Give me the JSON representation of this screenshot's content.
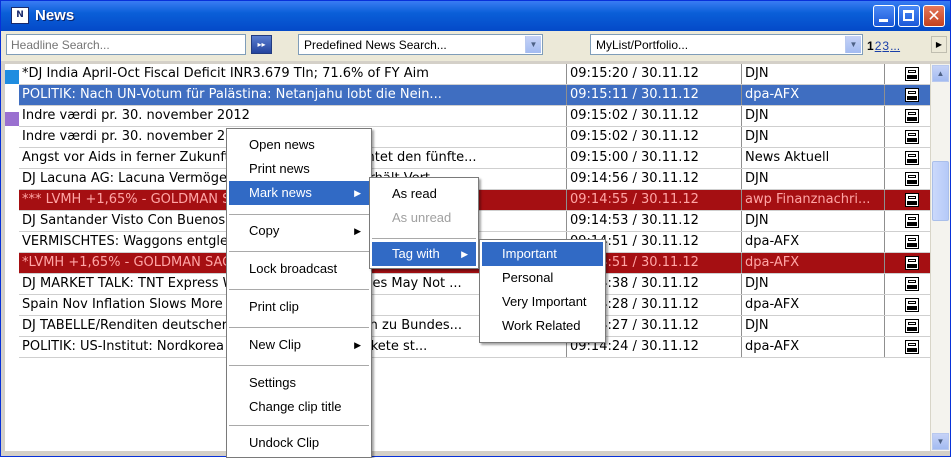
{
  "window": {
    "title": "News",
    "icon": "news-app-icon"
  },
  "toolbar": {
    "headline_search_placeholder": "Headline Search...",
    "go_label": "▸▸",
    "predefined_search": "Predefined News Search...",
    "mylist": "MyList/Portfolio...",
    "pages": [
      "1",
      "2",
      "3"
    ],
    "pages_more": "..."
  },
  "colors": {
    "selected_row": "#3f6ec1",
    "alert_row": "#a50f12",
    "marker_blue": "#1f8de0",
    "marker_purple": "#9a70d0",
    "title_bar": "#0a5fd8"
  },
  "rows": [
    {
      "headline": "*DJ India April-Oct Fiscal Deficit INR3.679 Tln; 71.6% of FY Aim",
      "time": "09:15:20 / 30.11.12",
      "source": "DJN"
    },
    {
      "headline": "POLITIK: Nach UN-Votum für Palästina: Netanjahu lobt die Nein...",
      "time": "09:15:11 / 30.11.12",
      "source": "dpa-AFX"
    },
    {
      "headline": "Indre værdi pr. 30. november 2012",
      "time": "09:15:02 / 30.11.12",
      "source": "DJN"
    },
    {
      "headline": "Indre værdi pr. 30. november 2012",
      "time": "09:15:02 / 30.11.12",
      "source": "DJN"
    },
    {
      "headline": "Angst vor Aids in ferner Zukunft: Jeder Deutsche fürchtet den fünfte...",
      "time": "09:15:00 / 30.11.12",
      "source": "News Aktuell"
    },
    {
      "headline": "DJ Lacuna AG: Lacuna Vermögensverwaltung Fonds erhält Vert...",
      "time": "09:14:56 / 30.11.12",
      "source": "DJN"
    },
    {
      "headline": "*** LVMH +1,65% - GOLDMAN SACHS: 'BUY'",
      "time": "09:14:55 / 30.11.12",
      "source": "awp Finanznachri..."
    },
    {
      "headline": "DJ Santander Visto Con Buenos Ojos Por Fondo Catalunya Caixa",
      "time": "09:14:53 / 30.11.12",
      "source": "DJN"
    },
    {
      "headline": "VERMISCHTES: Waggons entgleist - Bahnverkehr ist im Stuttgart...",
      "time": "09:14:51 / 30.11.12",
      "source": "dpa-AFX"
    },
    {
      "headline": "*LVMH +1,65% - GOLDMAN SACHS: 'BUY'",
      "time": "09:14:51 / 30.11.12",
      "source": "dpa-AFX"
    },
    {
      "headline": "DJ MARKET TALK: TNT Express Wilson Medical Remedies May Not ...",
      "time": "09:14:38 / 30.11.12",
      "source": "DJN"
    },
    {
      "headline": "Spain Nov Inflation Slows More Than Expected",
      "time": "09:14:28 / 30.11.12",
      "source": "dpa-AFX"
    },
    {
      "headline": "DJ TABELLE/Renditen deutscher Anleihen und Anleihen zu Bundes...",
      "time": "09:14:27 / 30.11.12",
      "source": "DJN"
    },
    {
      "headline": "POLITIK: US-Institut: Nordkorea testet Langstreckenrakete st...",
      "time": "09:14:24 / 30.11.12",
      "source": "dpa-AFX"
    }
  ],
  "context_menu": {
    "items": [
      "Open news",
      "Print news",
      "Mark news",
      "Copy",
      "Lock broadcast",
      "Print clip",
      "New Clip",
      "Settings",
      "Change clip title",
      "Undock Clip"
    ]
  },
  "mark_menu": {
    "items": [
      "As read",
      "As unread",
      "Tag with"
    ]
  },
  "tag_menu": {
    "items": [
      "Important",
      "Personal",
      "Very Important",
      "Work Related"
    ]
  }
}
